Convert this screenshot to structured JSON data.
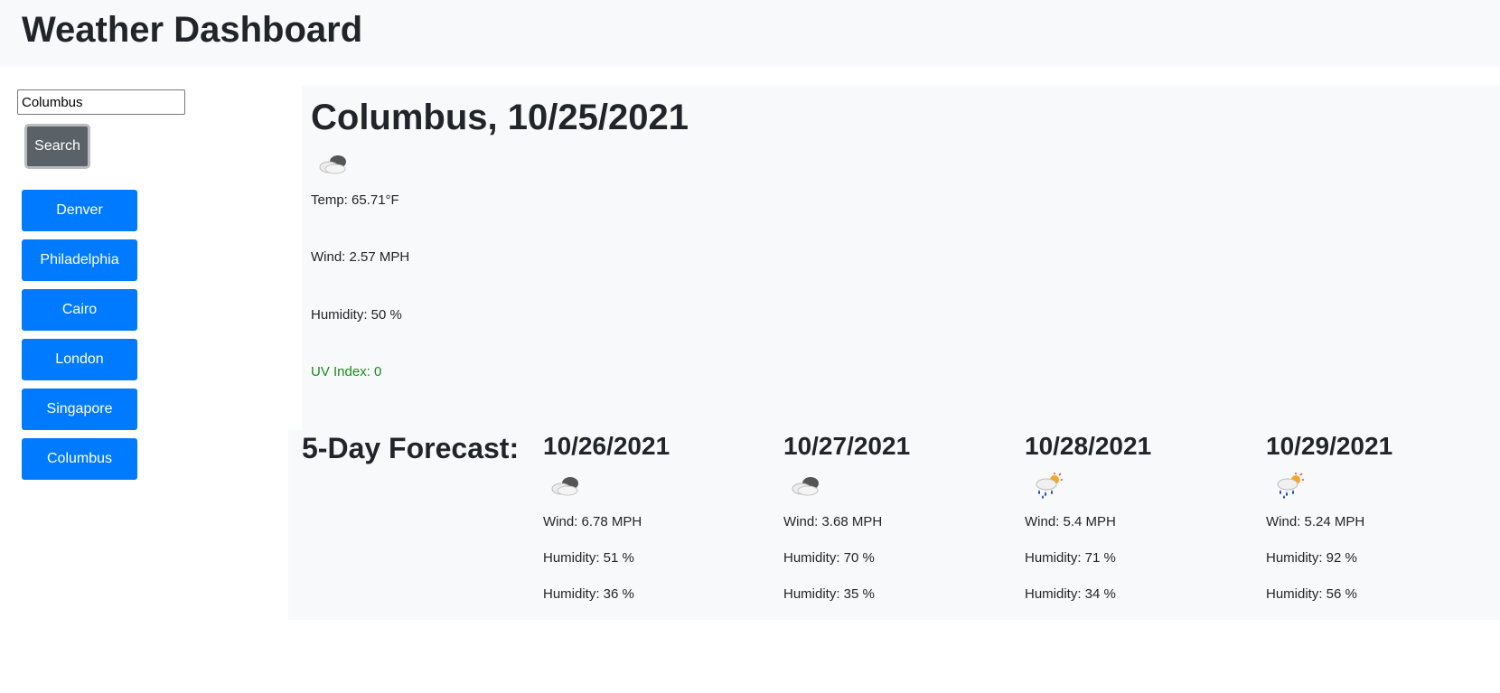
{
  "header": {
    "title": "Weather Dashboard"
  },
  "search": {
    "value": "Columbus",
    "button_label": "Search"
  },
  "history": [
    "Denver",
    "Philadelphia",
    "Cairo",
    "London",
    "Singapore",
    "Columbus"
  ],
  "current": {
    "title": "Columbus, 10/25/2021",
    "icon": "cloudy-night-icon",
    "temp": "Temp: 65.71°F",
    "wind": "Wind: 2.57 MPH",
    "humidity": "Humidity: 50 %",
    "uv": "UV Index: 0",
    "uv_color": "#198c19"
  },
  "forecast": {
    "title": "5-Day Forecast:",
    "days": [
      {
        "date": "10/26/2021",
        "icon": "cloudy-night-icon",
        "wind": "Wind: 6.78 MPH",
        "humidity1": "Humidity: 51 %",
        "humidity2": "Humidity: 36 %"
      },
      {
        "date": "10/27/2021",
        "icon": "cloudy-night-icon",
        "wind": "Wind: 3.68 MPH",
        "humidity1": "Humidity: 70 %",
        "humidity2": "Humidity: 35 %"
      },
      {
        "date": "10/28/2021",
        "icon": "rain-sun-icon",
        "wind": "Wind: 5.4 MPH",
        "humidity1": "Humidity: 71 %",
        "humidity2": "Humidity: 34 %"
      },
      {
        "date": "10/29/2021",
        "icon": "rain-sun-icon",
        "wind": "Wind: 5.24 MPH",
        "humidity1": "Humidity: 92 %",
        "humidity2": "Humidity: 56 %"
      }
    ]
  },
  "colors": {
    "header_bg": "#f8f9fa",
    "city_button": "#007bff",
    "search_button": "#5a6268"
  }
}
